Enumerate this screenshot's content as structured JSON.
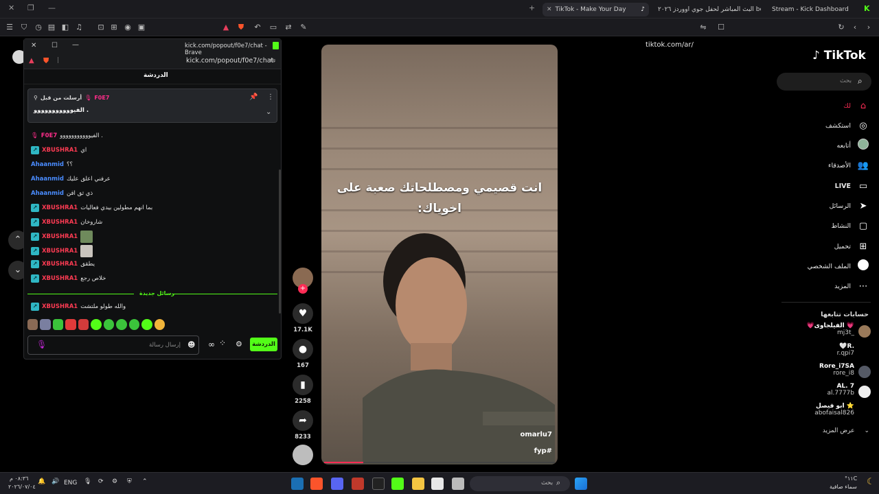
{
  "browser": {
    "tabs": [
      {
        "label": "Stream - Kick Dashboard",
        "active": false
      },
      {
        "label": "البث المباشر لحفل جوي اووردز ٢٠٢٦ be.",
        "active": false
      },
      {
        "label": "TikTok - Make Your Day",
        "active": true
      }
    ],
    "address": "tiktok.com/ar/"
  },
  "popout": {
    "window_title": "kick.com/popout/f0e7/chat - Brave",
    "address": "kick.com/popout/f0e7/chat",
    "header_title": "الدردشة",
    "pinned": {
      "label": "أرسلت من قبل",
      "user": "F0E7",
      "text": "الفيووووووووووو ."
    },
    "messages": [
      {
        "user": "F0E7",
        "color": "pink",
        "badge": "mic",
        "text": "الفيووووووووووو ."
      },
      {
        "user": "XBUSHRA1",
        "color": "red",
        "badge": "kick",
        "text": "اي"
      },
      {
        "user": "Ahaanmid",
        "color": "blue",
        "badge": "",
        "text": "؟؟"
      },
      {
        "user": "Ahaanmid",
        "color": "blue",
        "badge": "",
        "text": "عرفني اعلق عليك"
      },
      {
        "user": "Ahaanmid",
        "color": "blue",
        "badge": "",
        "text": "ذي ثق اقن"
      },
      {
        "user": "XBUSHRA1",
        "color": "red",
        "badge": "kick",
        "text": "بما انهم مطولين بيدي فعاليات"
      },
      {
        "user": "XBUSHRA1",
        "color": "red",
        "badge": "kick",
        "text": "شاروخان"
      },
      {
        "user": "XBUSHRA1",
        "color": "red",
        "badge": "kick",
        "text": "",
        "emote": true
      },
      {
        "user": "XBUSHRA1",
        "color": "red",
        "badge": "kick",
        "text": "",
        "emote": true
      },
      {
        "user": "XBUSHRA1",
        "color": "red",
        "badge": "kick",
        "text": "يطقق"
      },
      {
        "user": "XBUSHRA1",
        "color": "red",
        "badge": "kick",
        "text": "خلاص رجع"
      }
    ],
    "new_messages_label": "رسائل جديدة",
    "last_message": {
      "user": "XBUSHRA1",
      "text": "والله طولو ملتشت"
    },
    "input_placeholder": "إرسال رسالة",
    "chat_button": "الدردشة"
  },
  "video": {
    "caption_line1": "انت قصيمي ومصطلحاتك صعبة على",
    "caption_line2": "اخوياك:",
    "author": "omarlu7",
    "hashtag": "fyp#",
    "progress": 0.17
  },
  "actions": {
    "likes": "17.1K",
    "comments": "167",
    "saves": "2258",
    "shares": "8233"
  },
  "tiktok_nav": {
    "logo": "TikTok",
    "search_placeholder": "بحث",
    "items": [
      "لك",
      "استكشف",
      "أتابعه",
      "الأصدقاء",
      "LIVE",
      "الرسائل",
      "النشاط",
      "تحميل",
      "الملف الشخصي",
      "المزيد"
    ],
    "following_title": "حسابات تتابعها",
    "following": [
      {
        "name": "💗الفيلجاوى 💗",
        "handle": "mj3t_"
      },
      {
        "name": "🤍R.",
        "handle": "r.qpi7"
      },
      {
        "name": "Rore_i7SA",
        "handle": "rore_i8"
      },
      {
        "name": "AL. 7",
        "handle": "al.7777b"
      },
      {
        "name": "ابو فيصل ⭐",
        "handle": "abofaisal826"
      }
    ],
    "see_more": "عرض المزيد"
  },
  "taskbar": {
    "time": "٠٨:٣٦ م",
    "date": "٢٠٢٦/٠٧/٠٤",
    "lang": "ENG",
    "search": "بحث",
    "weather_temp": "°١١C",
    "weather_text": "سماء صافية"
  }
}
